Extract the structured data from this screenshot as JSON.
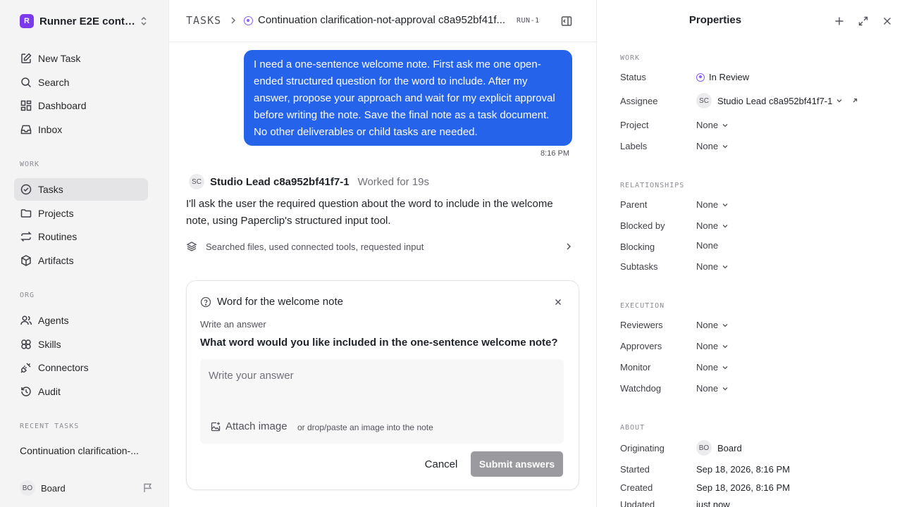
{
  "workspace": {
    "logo": "R",
    "name": "Runner E2E conti..."
  },
  "nav_main": [
    {
      "id": "new-task",
      "label": "New Task",
      "icon": "edit-icon"
    },
    {
      "id": "search",
      "label": "Search",
      "icon": "search-icon"
    },
    {
      "id": "dashboard",
      "label": "Dashboard",
      "icon": "dashboard-icon"
    },
    {
      "id": "inbox",
      "label": "Inbox",
      "icon": "inbox-icon"
    }
  ],
  "work_label": "WORK",
  "nav_work": [
    {
      "id": "tasks",
      "label": "Tasks",
      "active": true
    },
    {
      "id": "projects",
      "label": "Projects"
    },
    {
      "id": "routines",
      "label": "Routines"
    },
    {
      "id": "artifacts",
      "label": "Artifacts"
    }
  ],
  "org_label": "ORG",
  "nav_org": [
    {
      "id": "agents",
      "label": "Agents"
    },
    {
      "id": "skills",
      "label": "Skills"
    },
    {
      "id": "connectors",
      "label": "Connectors"
    },
    {
      "id": "audit",
      "label": "Audit"
    }
  ],
  "recent_label": "RECENT TASKS",
  "recent_tasks": [
    "Continuation clarification-..."
  ],
  "sidebar_footer": {
    "avatar": "BO",
    "name": "Board"
  },
  "breadcrumb": {
    "root": "TASKS",
    "title": "Continuation clarification-not-approval c8a952bf41f...",
    "run": "RUN-1"
  },
  "user_message": {
    "text": "I need a one-sentence welcome note. First ask me one open-ended structured question for the word to include. After my answer, propose your approach and wait for my explicit approval before writing the note. Save the final note as a task document. No other deliverables or child tasks are needed.",
    "time": "8:16 PM"
  },
  "agent_message": {
    "avatar": "SC",
    "name": "Studio Lead c8a952bf41f7-1",
    "worked": "Worked for 19s",
    "text": "I'll ask the user the required question about the word to include in the welcome note, using Paperclip's structured input tool.",
    "activity": "Searched files, used connected tools, requested input"
  },
  "question_card": {
    "title": "Word for the welcome note",
    "subtitle": "Write an answer",
    "question": "What word would you like included in the one-sentence welcome note?",
    "placeholder": "Write your answer",
    "attach_label": "Attach image",
    "drop_hint": "or drop/paste an image into the note",
    "cancel_label": "Cancel",
    "submit_label": "Submit answers"
  },
  "properties": {
    "title": "Properties",
    "work_label": "WORK",
    "status": {
      "label": "Status",
      "value": "In Review",
      "color": "#8b5cf6"
    },
    "assignee": {
      "label": "Assignee",
      "avatar": "SC",
      "value": "Studio Lead c8a952bf41f7-1"
    },
    "project": {
      "label": "Project",
      "value": "None"
    },
    "labels": {
      "label": "Labels",
      "value": "None"
    },
    "relationships_label": "RELATIONSHIPS",
    "parent": {
      "label": "Parent",
      "value": "None"
    },
    "blocked_by": {
      "label": "Blocked by",
      "value": "None"
    },
    "blocking": {
      "label": "Blocking",
      "value": "None"
    },
    "subtasks": {
      "label": "Subtasks",
      "value": "None"
    },
    "execution_label": "EXECUTION",
    "reviewers": {
      "label": "Reviewers",
      "value": "None"
    },
    "approvers": {
      "label": "Approvers",
      "value": "None"
    },
    "monitor": {
      "label": "Monitor",
      "value": "None"
    },
    "watchdog": {
      "label": "Watchdog",
      "value": "None"
    },
    "about_label": "ABOUT",
    "originating": {
      "label": "Originating",
      "avatar": "BO",
      "value": "Board"
    },
    "started": {
      "label": "Started",
      "value": "Sep 18, 2026, 8:16 PM"
    },
    "created": {
      "label": "Created",
      "value": "Sep 18, 2026, 8:16 PM"
    },
    "updated": {
      "label": "Updated",
      "value": "just now"
    }
  },
  "colors": {
    "accent": "#2563eb",
    "status": "#8b5cf6",
    "workspace": "#7c3aed",
    "submit_disabled": "#9a9a9f"
  }
}
